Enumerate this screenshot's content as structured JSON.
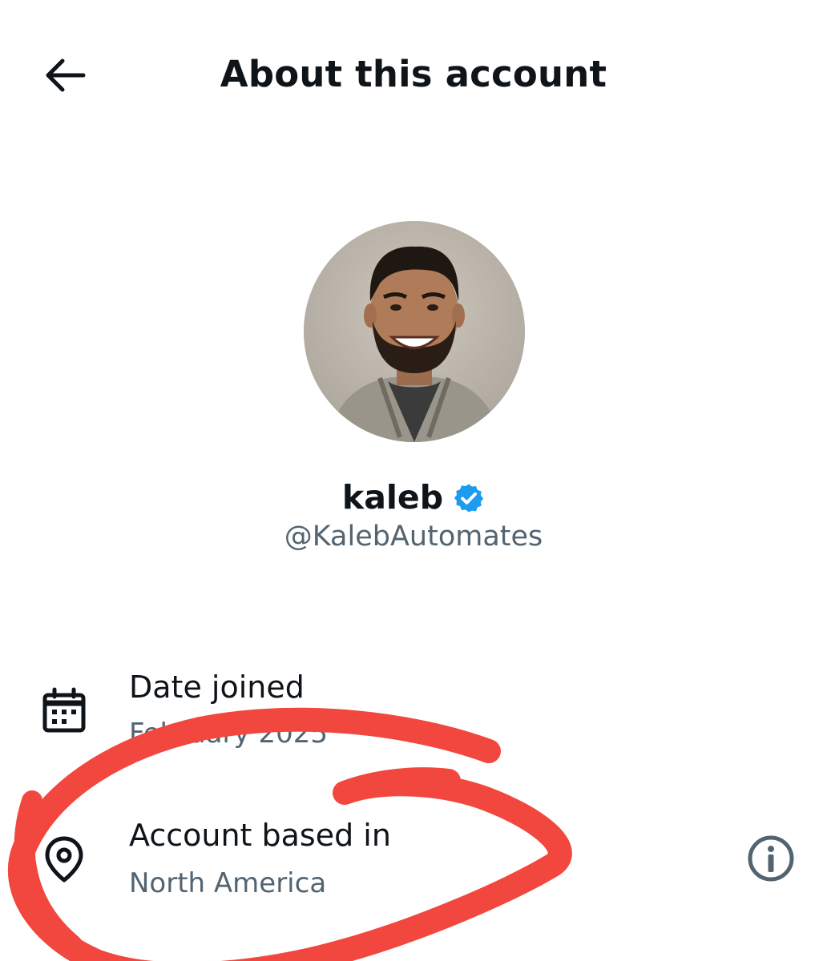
{
  "header": {
    "title": "About this account",
    "back_icon": "arrow-left-icon"
  },
  "profile": {
    "display_name": "kaleb",
    "handle": "@KalebAutomates",
    "verified_icon": "verified-badge-icon",
    "verified_color": "#1d9bf0"
  },
  "details": {
    "date_joined": {
      "icon": "calendar-icon",
      "label": "Date joined",
      "value": "February 2025"
    },
    "account_based": {
      "icon": "location-pin-icon",
      "label": "Account based in",
      "value": "North America",
      "info_icon": "info-icon"
    }
  },
  "annotation": {
    "color": "#f2473e",
    "shape": "hand-drawn ellipse"
  }
}
